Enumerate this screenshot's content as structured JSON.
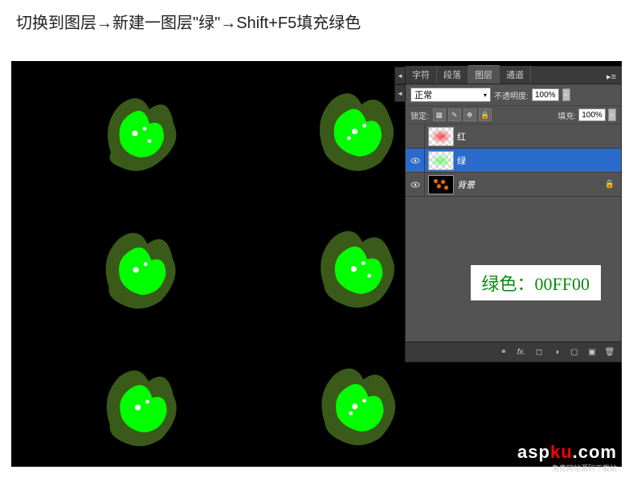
{
  "instruction": "切换到图层→新建一图层\"绿\"→Shift+F5填充绿色",
  "panel": {
    "tabs": [
      "字符",
      "段落",
      "图层",
      "通道"
    ],
    "active_tab": 2,
    "blend_mode": "正常",
    "opacity_label": "不透明度:",
    "opacity_value": "100%",
    "lock_label": "锁定:",
    "fill_label": "填充:",
    "fill_value": "100%"
  },
  "layers": [
    {
      "name": "红",
      "visible": false,
      "thumb": "red",
      "selected": false,
      "locked": false
    },
    {
      "name": "绿",
      "visible": true,
      "thumb": "green",
      "selected": true,
      "locked": false
    },
    {
      "name": "背景",
      "visible": true,
      "thumb": "bg",
      "selected": false,
      "locked": true,
      "italic": true
    }
  ],
  "annotation": "绿色：00FF00",
  "watermark": {
    "brand_a": "asp",
    "brand_b": "ku",
    "brand_c": ".com",
    "tagline": "免费网站源码下载站"
  }
}
